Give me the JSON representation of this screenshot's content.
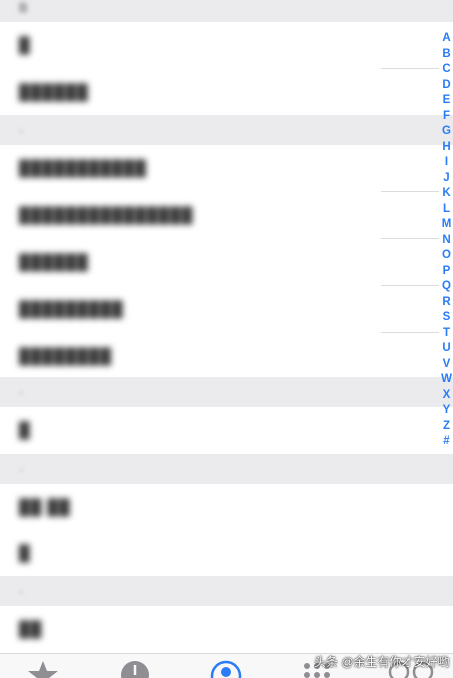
{
  "sections": [
    {
      "header": "B",
      "rows": [
        "·",
        "·",
        "·"
      ]
    },
    {
      "header": "·",
      "rows": [
        "·",
        "·",
        "·",
        "·",
        "·"
      ]
    },
    {
      "header": "·",
      "rows": [
        "·"
      ]
    },
    {
      "header": "·",
      "rows": [
        "·",
        "·"
      ]
    },
    {
      "header": "·",
      "rows": [
        "·"
      ]
    }
  ],
  "index_letters": [
    "A",
    "B",
    "C",
    "D",
    "E",
    "F",
    "G",
    "H",
    "I",
    "J",
    "K",
    "L",
    "M",
    "N",
    "O",
    "P",
    "Q",
    "R",
    "S",
    "T",
    "U",
    "V",
    "W",
    "X",
    "Y",
    "Z",
    "#"
  ],
  "tabbar": {
    "tabs": [
      {
        "icon": "star-icon",
        "active": false
      },
      {
        "icon": "clock-icon",
        "active": false
      },
      {
        "icon": "contacts-icon",
        "active": true
      },
      {
        "icon": "keypad-icon",
        "active": false
      },
      {
        "icon": "voicemail-icon",
        "active": false
      }
    ]
  },
  "watermark": "头条 @余生有你才安好哟",
  "colors": {
    "accent": "#2a7cf6",
    "section_bg": "#ebebed",
    "inactive_icon": "#8e8e93"
  }
}
